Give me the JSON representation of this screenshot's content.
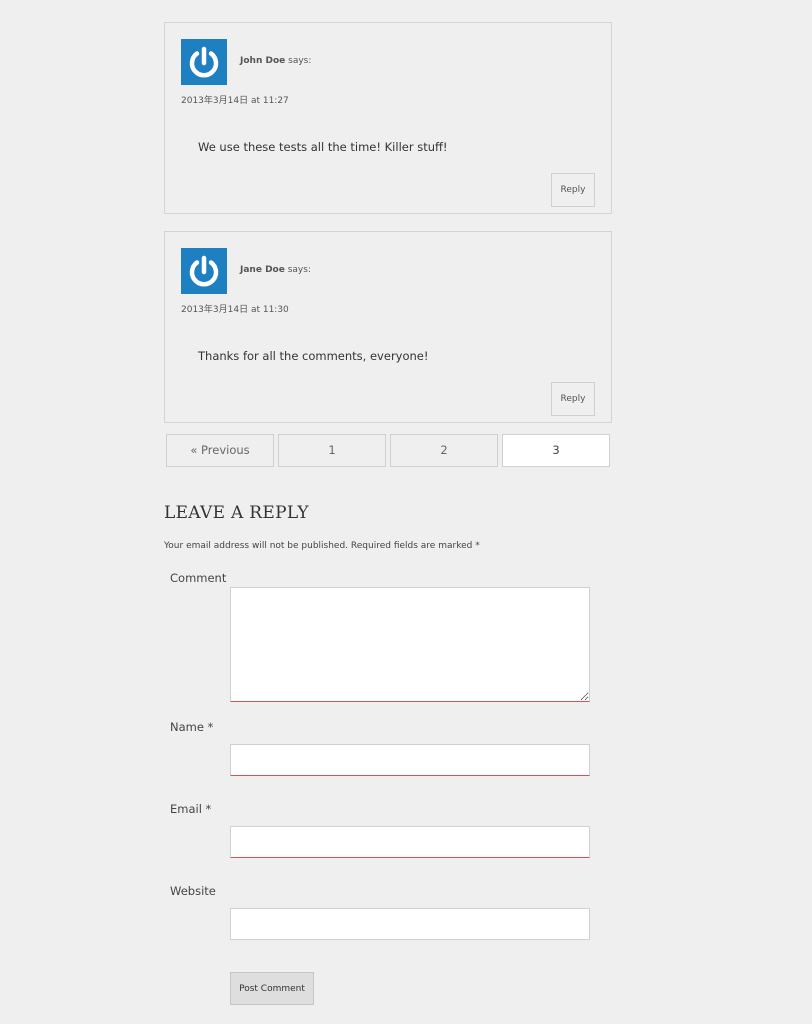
{
  "comments": [
    {
      "author": "John Doe",
      "says": "says:",
      "date": "2013年3月14日 at 11:27",
      "text": "We use these tests all the time! Killer stuff!",
      "reply_label": "Reply"
    },
    {
      "author": "Jane Doe",
      "says": "says:",
      "date": "2013年3月14日 at 11:30",
      "text": "Thanks for all the comments, everyone!",
      "reply_label": "Reply"
    }
  ],
  "pagination": {
    "previous": "« Previous",
    "pages": [
      "1",
      "2",
      "3"
    ],
    "current": "3"
  },
  "reply_form": {
    "title": "LEAVE A REPLY",
    "notes": "Your email address will not be published. Required fields are marked *",
    "comment_label": "Comment",
    "comment_value": "",
    "name_label": "Name *",
    "name_value": "",
    "email_label": "Email *",
    "email_value": "",
    "website_label": "Website",
    "website_value": "",
    "submit_label": "Post Comment"
  },
  "colors": {
    "background": "#efefef",
    "avatar": "#1e7fc1",
    "required_border": "#d9534f"
  },
  "icons": {
    "avatar": "power-icon"
  }
}
